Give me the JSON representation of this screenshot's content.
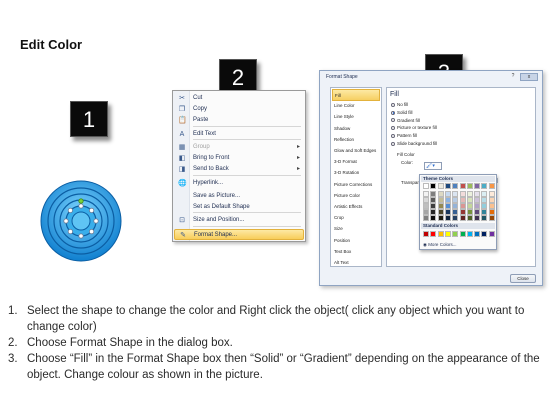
{
  "title": "Edit Color",
  "badges": [
    "1",
    "2",
    "3"
  ],
  "context_menu": {
    "items": [
      {
        "label": "Cut",
        "icon": "scissors-icon",
        "glyph": "✂",
        "submenu": false,
        "disabled": false,
        "highlight": false
      },
      {
        "label": "Copy",
        "icon": "copy-icon",
        "glyph": "❐",
        "submenu": false,
        "disabled": false,
        "highlight": false
      },
      {
        "label": "Paste",
        "icon": "paste-icon",
        "glyph": "📋",
        "submenu": false,
        "disabled": false,
        "highlight": false
      },
      {
        "label": "Edit Text",
        "icon": "edit-text-icon",
        "glyph": "A",
        "submenu": false,
        "disabled": false,
        "highlight": false
      },
      {
        "label": "Group",
        "icon": "group-icon",
        "glyph": "▦",
        "submenu": true,
        "disabled": true,
        "highlight": false
      },
      {
        "label": "Bring to Front",
        "icon": "bring-to-front-icon",
        "glyph": "◧",
        "submenu": true,
        "disabled": false,
        "highlight": false
      },
      {
        "label": "Send to Back",
        "icon": "send-to-back-icon",
        "glyph": "◨",
        "submenu": true,
        "disabled": false,
        "highlight": false
      },
      {
        "label": "Hyperlink...",
        "icon": "hyperlink-icon",
        "glyph": "🌐",
        "submenu": false,
        "disabled": false,
        "highlight": false
      },
      {
        "label": "Save as Picture...",
        "icon": "",
        "glyph": "",
        "submenu": false,
        "disabled": false,
        "highlight": false
      },
      {
        "label": "Set as Default Shape",
        "icon": "",
        "glyph": "",
        "submenu": false,
        "disabled": false,
        "highlight": false
      },
      {
        "label": "Size and Position...",
        "icon": "size-position-icon",
        "glyph": "⊡",
        "submenu": false,
        "disabled": false,
        "highlight": false
      },
      {
        "label": "Format Shape...",
        "icon": "format-shape-icon",
        "glyph": "✎",
        "submenu": false,
        "disabled": false,
        "highlight": true
      }
    ]
  },
  "dialog": {
    "title": "Format Shape",
    "close_glyph": "x",
    "help_glyph": "?",
    "categories": [
      "Fill",
      "Line Color",
      "Line Style",
      "Shadow",
      "Reflection",
      "Glow and Soft Edges",
      "3-D Format",
      "3-D Rotation",
      "Picture Corrections",
      "Picture Color",
      "Artistic Effects",
      "Crop",
      "Size",
      "Position",
      "Text Box",
      "Alt Text"
    ],
    "selected_category": "Fill",
    "fill_heading": "Fill",
    "fill_options": [
      {
        "label": "No fill",
        "on": false
      },
      {
        "label": "Solid fill",
        "on": true
      },
      {
        "label": "Gradient fill",
        "on": false
      },
      {
        "label": "Picture or texture fill",
        "on": false
      },
      {
        "label": "Pattern fill",
        "on": false
      },
      {
        "label": "Slide background fill",
        "on": false
      }
    ],
    "fill_color_label": "Fill Color",
    "color_label": "Color:",
    "transparency_label": "Transparency:",
    "close_button": "Close"
  },
  "palette": {
    "theme_label": "Theme Colors",
    "standard_label": "Standard Colors",
    "more_label": "More Colors...",
    "theme_top": [
      "#ffffff",
      "#000000",
      "#eeece1",
      "#1f497d",
      "#4f81bd",
      "#c0504d",
      "#9bbb59",
      "#8064a2",
      "#4bacc6",
      "#f79646"
    ],
    "theme_shades": [
      [
        "#f2f2f2",
        "#7f7f7f",
        "#ddd9c3",
        "#c6d9f0",
        "#dbe5f1",
        "#f2dcdb",
        "#ebf1dd",
        "#e5e0ec",
        "#dbeef3",
        "#fdeada"
      ],
      [
        "#d8d8d8",
        "#595959",
        "#c4bd97",
        "#8db3e2",
        "#b8cce4",
        "#e5b9b7",
        "#d7e3bc",
        "#ccc1d9",
        "#b7dde8",
        "#fbd5b5"
      ],
      [
        "#bfbfbf",
        "#3f3f3f",
        "#938953",
        "#548dd4",
        "#95b3d7",
        "#d99694",
        "#c3d69b",
        "#b2a2c7",
        "#92cddc",
        "#fac08f"
      ],
      [
        "#a5a5a5",
        "#262626",
        "#494429",
        "#17365d",
        "#366092",
        "#953734",
        "#76923c",
        "#5f497a",
        "#31859b",
        "#e36c09"
      ],
      [
        "#7f7f7f",
        "#0c0c0c",
        "#1d1b10",
        "#0f243e",
        "#244061",
        "#632423",
        "#4f6128",
        "#3f3151",
        "#205867",
        "#974806"
      ]
    ],
    "standard": [
      "#c00000",
      "#ff0000",
      "#ffc000",
      "#ffff00",
      "#92d050",
      "#00b050",
      "#00b0f0",
      "#0070c0",
      "#002060",
      "#7030a0"
    ]
  },
  "instructions": [
    {
      "num": "1.",
      "text": "Select the shape to change the color and Right click the object( click any object which you want to change color)"
    },
    {
      "num": "2.",
      "text": "Choose Format Shape in the dialog box."
    },
    {
      "num": "3.",
      "text": "Choose “Fill” in the Format Shape box then “Solid” or “Gradient” depending on the appearance of the object. Change colour as shown in the picture."
    }
  ]
}
